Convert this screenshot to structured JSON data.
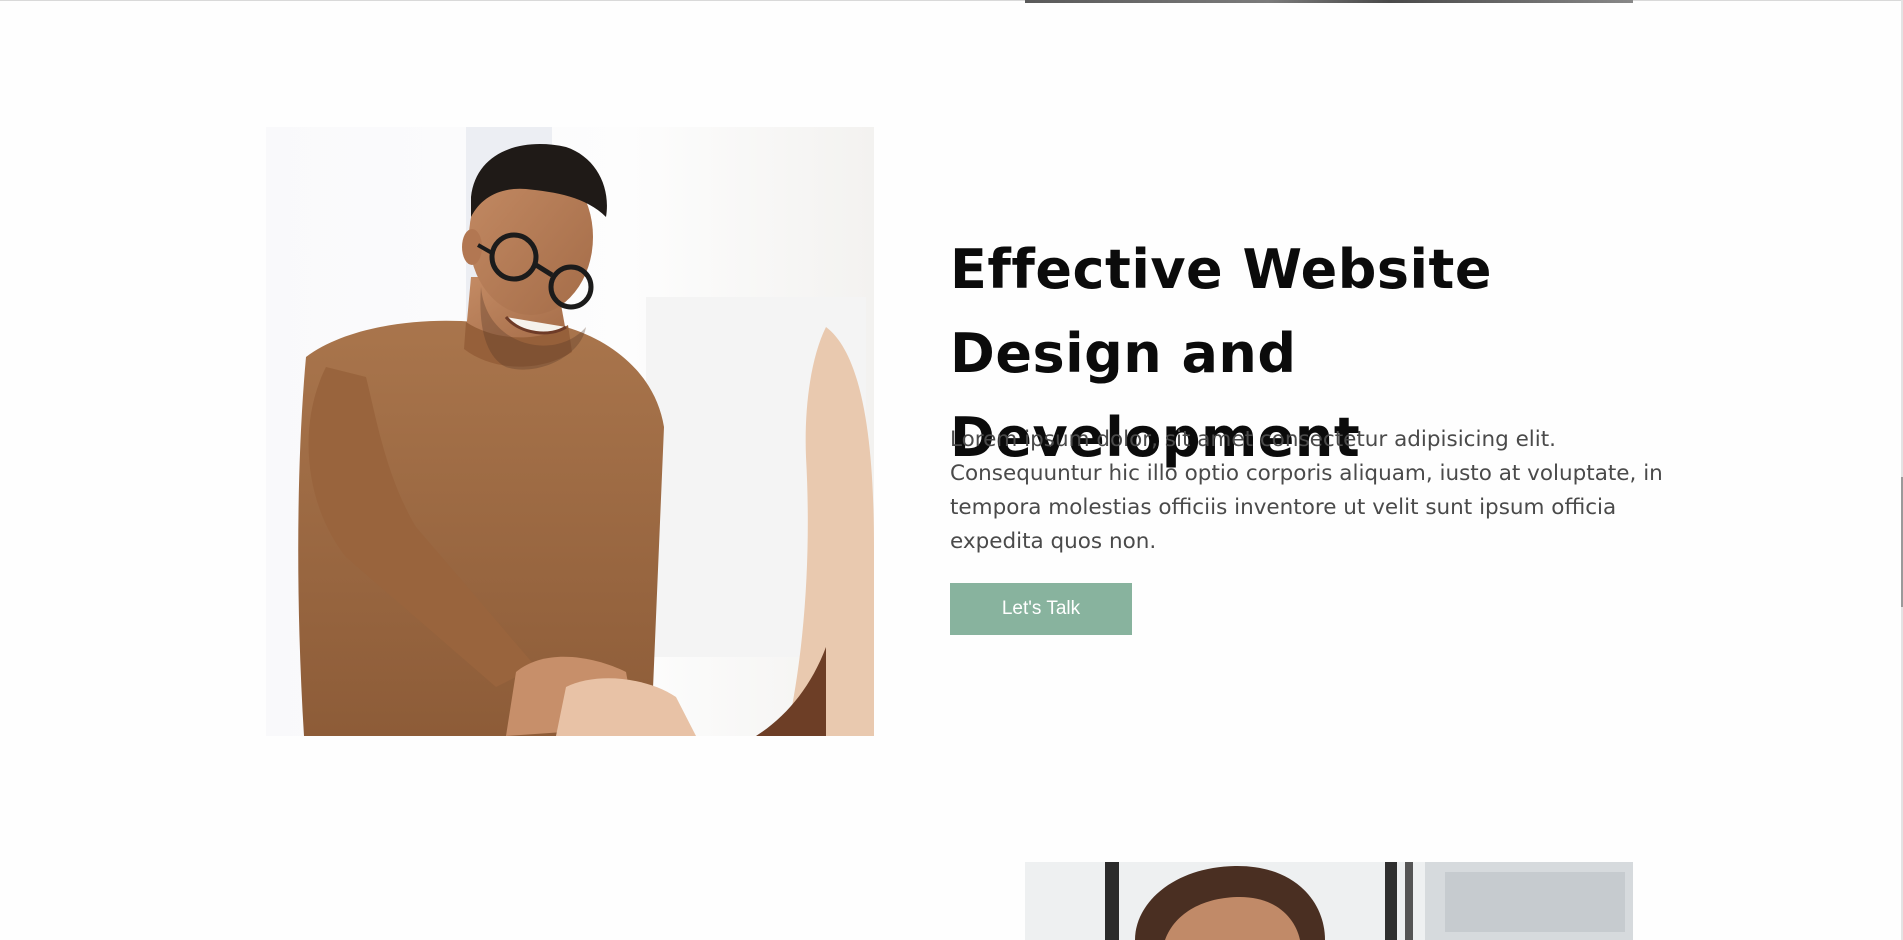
{
  "feature": {
    "headline": "Effective Website Design and Development",
    "description": "Lorem ipsum dolor, sit amet consectetur adipisicing elit. Consequuntur hic illo optio corporis aliquam, iusto at voluptate, in tempora molestias officiis inventore ut velit sunt ipsum officia expedita quos non.",
    "cta_label": "Let's Talk"
  },
  "colors": {
    "accent": "#88b39e",
    "headline": "#0b0b0b",
    "body_text": "#4a4a4a",
    "background": "#fefefe"
  }
}
